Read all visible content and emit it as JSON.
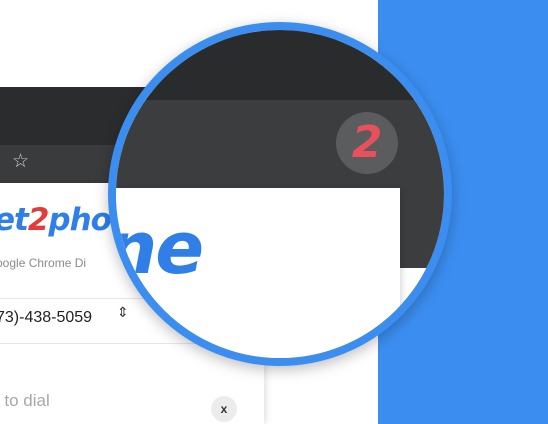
{
  "browser": {
    "star_glyph": "☆"
  },
  "popup": {
    "logo": {
      "part1": "et",
      "part2": "2",
      "part3": "pho"
    },
    "subtitle": "oogle Chrome Di",
    "phone_select": {
      "value": "73)-438-5059",
      "spinner_glyph": "⇕"
    },
    "number_input": {
      "placeholder": "r to dial"
    },
    "clear_button_label": "x"
  },
  "magnifier": {
    "badge_label": "2",
    "logo_fragment": "ne"
  },
  "colors": {
    "accent_blue": "#3b8ef0",
    "logo_blue": "#2f7fe6",
    "logo_red": "#e23b3b",
    "browser_dark": "#2b2c2e",
    "toolbar_dark": "#3a3b3d"
  },
  "icons": {
    "bookmark": "star-icon",
    "select_spinner": "spinner-icon",
    "extension": "extension-badge-icon"
  }
}
